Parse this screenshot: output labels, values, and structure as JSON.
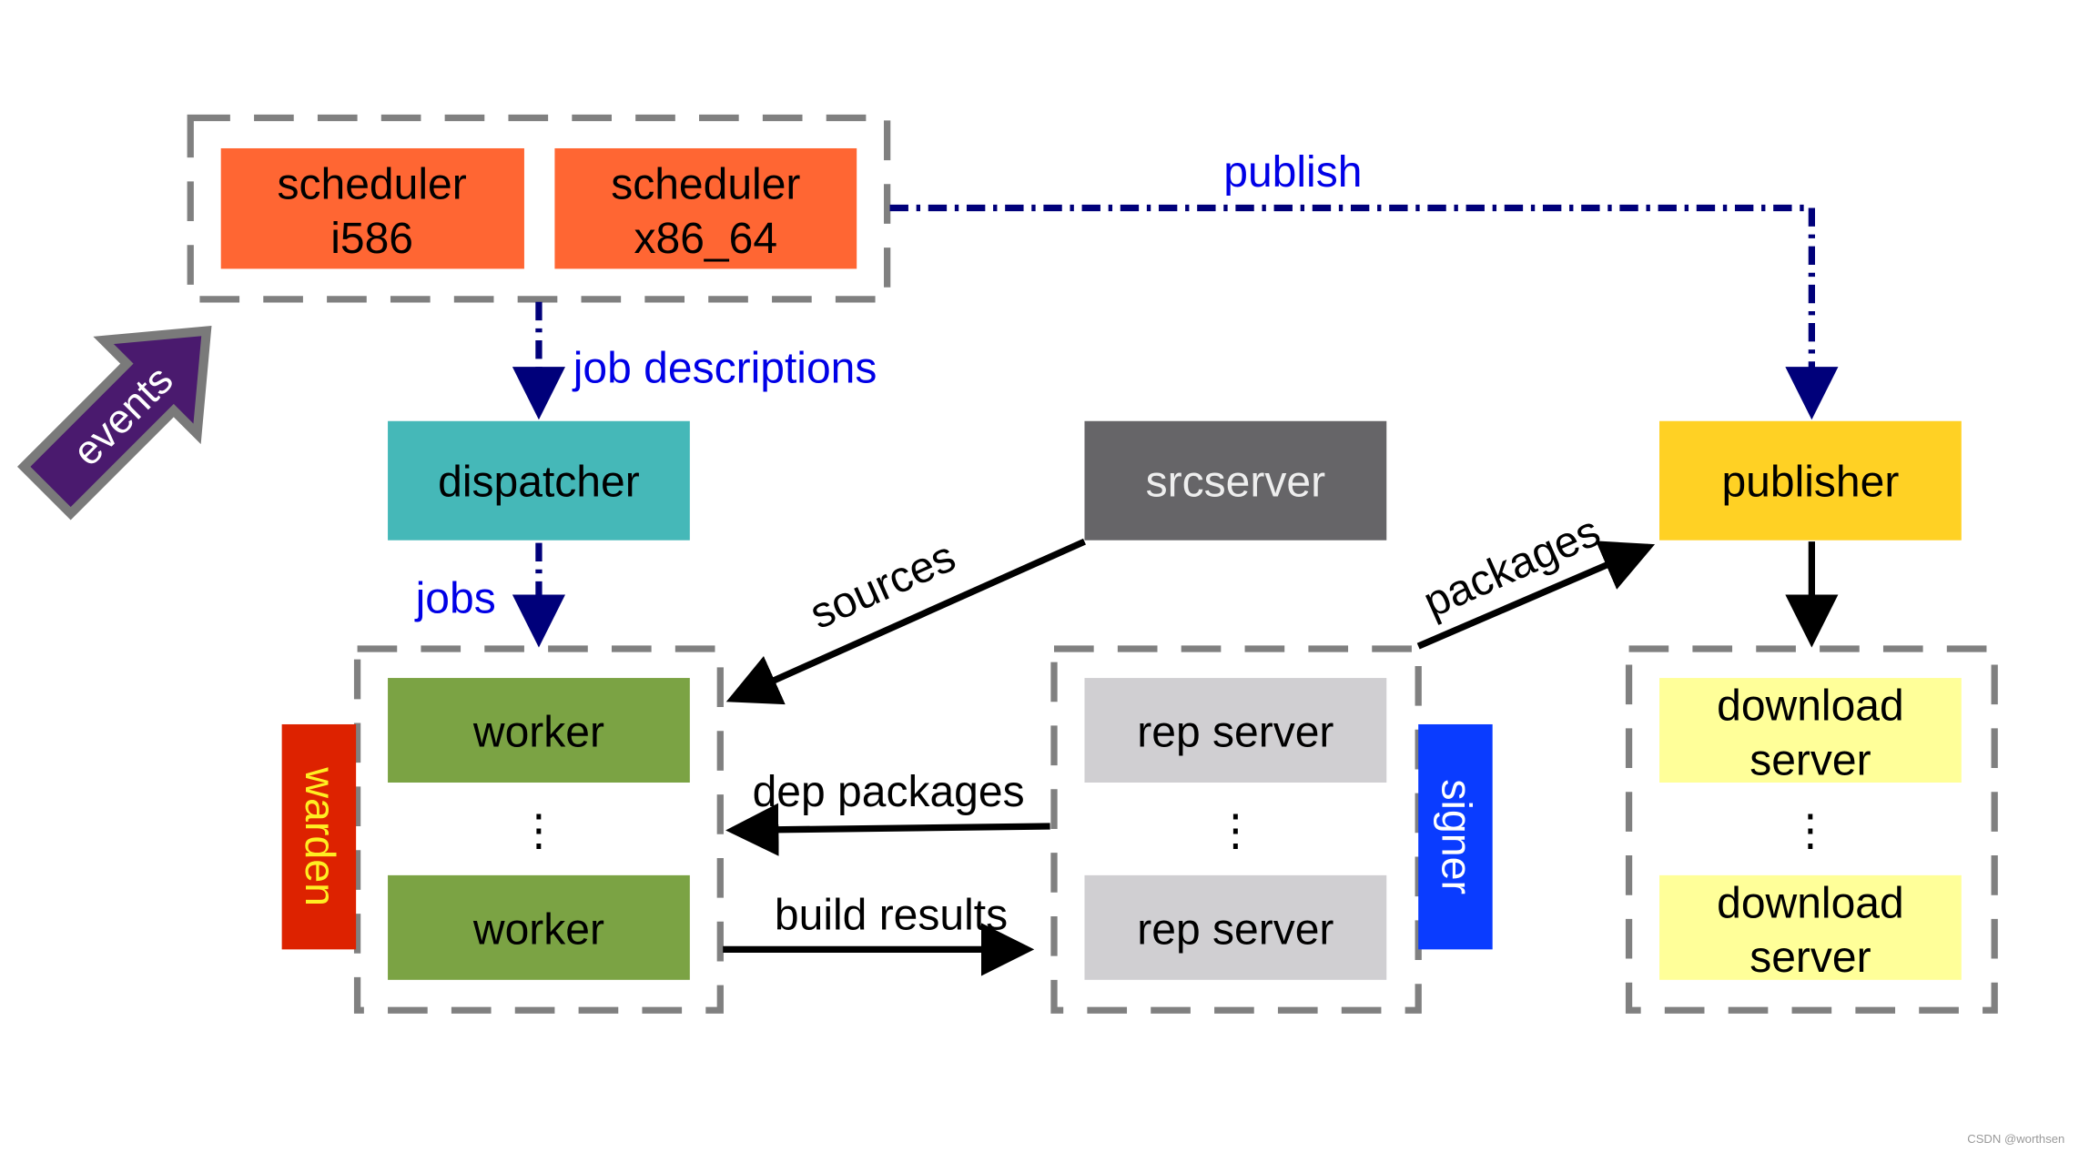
{
  "colors": {
    "scheduler": "#ff6633",
    "dispatcher": "#45b8b8",
    "srcserver": "#666568",
    "publisher": "#ffd124",
    "worker": "#7ba344",
    "rep_server": "#d0cfd2",
    "download_server": "#ffff99",
    "warden": "#dd2200",
    "signer": "#0a3cff",
    "events": "#4a1a6e",
    "label_blue": "#0000e6"
  },
  "nodes": {
    "scheduler_i586": [
      "scheduler",
      "i586"
    ],
    "scheduler_x86_64": [
      "scheduler",
      "x86_64"
    ],
    "dispatcher": "dispatcher",
    "srcserver": "srcserver",
    "publisher": "publisher",
    "worker": "worker",
    "rep_server": "rep server",
    "download_server": [
      "download",
      "server"
    ],
    "warden": "warden",
    "signer": "signer",
    "events": "events",
    "ellipsis": "⋮"
  },
  "edges": {
    "publish": "publish",
    "job_descriptions": "job descriptions",
    "jobs": "jobs",
    "sources": "sources",
    "packages": "packages",
    "dep_packages": "dep packages",
    "build_results": "build results"
  },
  "watermark": "CSDN @worthsen"
}
